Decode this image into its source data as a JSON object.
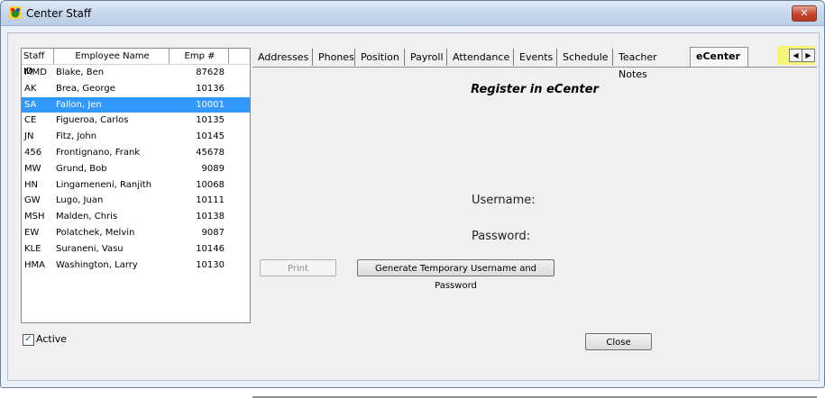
{
  "window": {
    "title": "Center Staff",
    "close_glyph": "✕"
  },
  "list": {
    "headers": [
      "Staff ID",
      "Employee Name",
      "Emp #"
    ],
    "rows": [
      {
        "id": "MMD",
        "name": "Blake, Ben",
        "emp": "87628",
        "selected": false
      },
      {
        "id": "AK",
        "name": "Brea, George",
        "emp": "10136",
        "selected": false
      },
      {
        "id": "SA",
        "name": "Fallon, Jen",
        "emp": "10001",
        "selected": true
      },
      {
        "id": "CE",
        "name": "Figueroa, Carlos",
        "emp": "10135",
        "selected": false
      },
      {
        "id": "JN",
        "name": "Fitz, John",
        "emp": "10145",
        "selected": false
      },
      {
        "id": "456",
        "name": "Frontignano, Frank",
        "emp": "45678",
        "selected": false
      },
      {
        "id": "MW",
        "name": "Grund, Bob",
        "emp": "9089",
        "selected": false
      },
      {
        "id": "HN",
        "name": "Lingameneni, Ranjith",
        "emp": "10068",
        "selected": false
      },
      {
        "id": "GW",
        "name": "Lugo, Juan",
        "emp": "10111",
        "selected": false
      },
      {
        "id": "MSH",
        "name": "Malden, Chris",
        "emp": "10138",
        "selected": false
      },
      {
        "id": "EW",
        "name": "Polatchek, Melvin",
        "emp": "9087",
        "selected": false
      },
      {
        "id": "KLE",
        "name": "Suraneni, Vasu",
        "emp": "10146",
        "selected": false
      },
      {
        "id": "HMA",
        "name": "Washington, Larry",
        "emp": "10130",
        "selected": false
      }
    ]
  },
  "active": {
    "label": "Active",
    "checked": true
  },
  "tabs": [
    "Addresses",
    "Phones",
    "Position",
    "Payroll",
    "Attendance",
    "Events",
    "Schedule",
    "Teacher Notes",
    "eCenter"
  ],
  "active_tab": "eCenter",
  "ecenter": {
    "title": "Register in eCenter",
    "username_label": "Username:",
    "password_label": "Password:",
    "print_label": "Print",
    "generate_label": "Generate Temporary Username and Password",
    "close_label": "Close"
  },
  "colors": {
    "selection": "#3399ff",
    "highlight": "#f6f57a"
  }
}
